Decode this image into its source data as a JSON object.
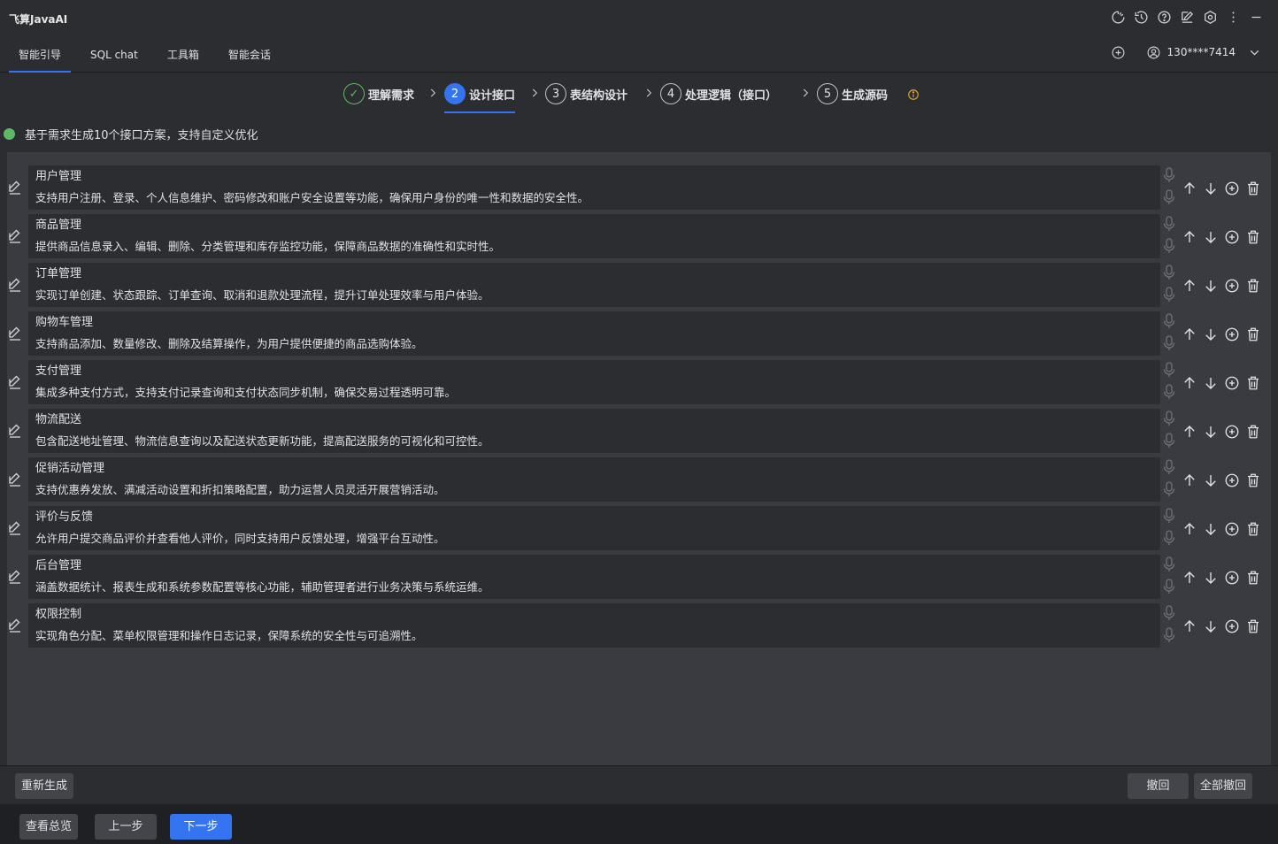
{
  "app": {
    "title": "飞算JavaAI"
  },
  "title_icons": [
    "refresh-spin-icon",
    "history-icon",
    "help-icon",
    "edit-note-icon",
    "settings-icon",
    "more-icon",
    "minimize-icon"
  ],
  "menu": {
    "tabs": [
      {
        "label": "智能引导",
        "active": true
      },
      {
        "label": "SQL chat",
        "active": false
      },
      {
        "label": "工具箱",
        "active": false
      },
      {
        "label": "智能会话",
        "active": false
      }
    ],
    "user": "130****7414"
  },
  "steps": [
    {
      "index": "✓",
      "label": "理解需求",
      "state": "done"
    },
    {
      "index": "2",
      "label": "设计接口",
      "state": "active"
    },
    {
      "index": "3",
      "label": "表结构设计",
      "state": "pending"
    },
    {
      "index": "4",
      "label": "处理逻辑（接口）",
      "state": "pending"
    },
    {
      "index": "5",
      "label": "生成源码",
      "state": "pending"
    }
  ],
  "summary": "基于需求生成10个接口方案，支持自定义优化",
  "interfaces": [
    {
      "title": "用户管理",
      "desc": "支持用户注册、登录、个人信息维护、密码修改和账户安全设置等功能，确保用户身份的唯一性和数据的安全性。"
    },
    {
      "title": "商品管理",
      "desc": "提供商品信息录入、编辑、删除、分类管理和库存监控功能，保障商品数据的准确性和实时性。"
    },
    {
      "title": "订单管理",
      "desc": "实现订单创建、状态跟踪、订单查询、取消和退款处理流程，提升订单处理效率与用户体验。"
    },
    {
      "title": "购物车管理",
      "desc": "支持商品添加、数量修改、删除及结算操作，为用户提供便捷的商品选购体验。"
    },
    {
      "title": "支付管理",
      "desc": "集成多种支付方式，支持支付记录查询和支付状态同步机制，确保交易过程透明可靠。"
    },
    {
      "title": "物流配送",
      "desc": "包含配送地址管理、物流信息查询以及配送状态更新功能，提高配送服务的可视化和可控性。"
    },
    {
      "title": "促销活动管理",
      "desc": "支持优惠券发放、满减活动设置和折扣策略配置，助力运营人员灵活开展营销活动。"
    },
    {
      "title": "评价与反馈",
      "desc": "允许用户提交商品评价并查看他人评价，同时支持用户反馈处理，增强平台互动性。"
    },
    {
      "title": "后台管理",
      "desc": "涵盖数据统计、报表生成和系统参数配置等核心功能，辅助管理者进行业务决策与系统运维。"
    },
    {
      "title": "权限控制",
      "desc": "实现角色分配、菜单权限管理和操作日志记录，保障系统的安全性与可追溯性。"
    }
  ],
  "bottom": {
    "regenerate": "重新生成",
    "undo": "撤回",
    "undo_all": "全部撤回"
  },
  "footer": {
    "overview": "查看总览",
    "prev": "上一步",
    "next": "下一步"
  },
  "colors": {
    "accent": "#3574f0",
    "success": "#5fb865",
    "warning": "#e5a23b",
    "background": "#2b2d30",
    "panel": "#393b40"
  }
}
